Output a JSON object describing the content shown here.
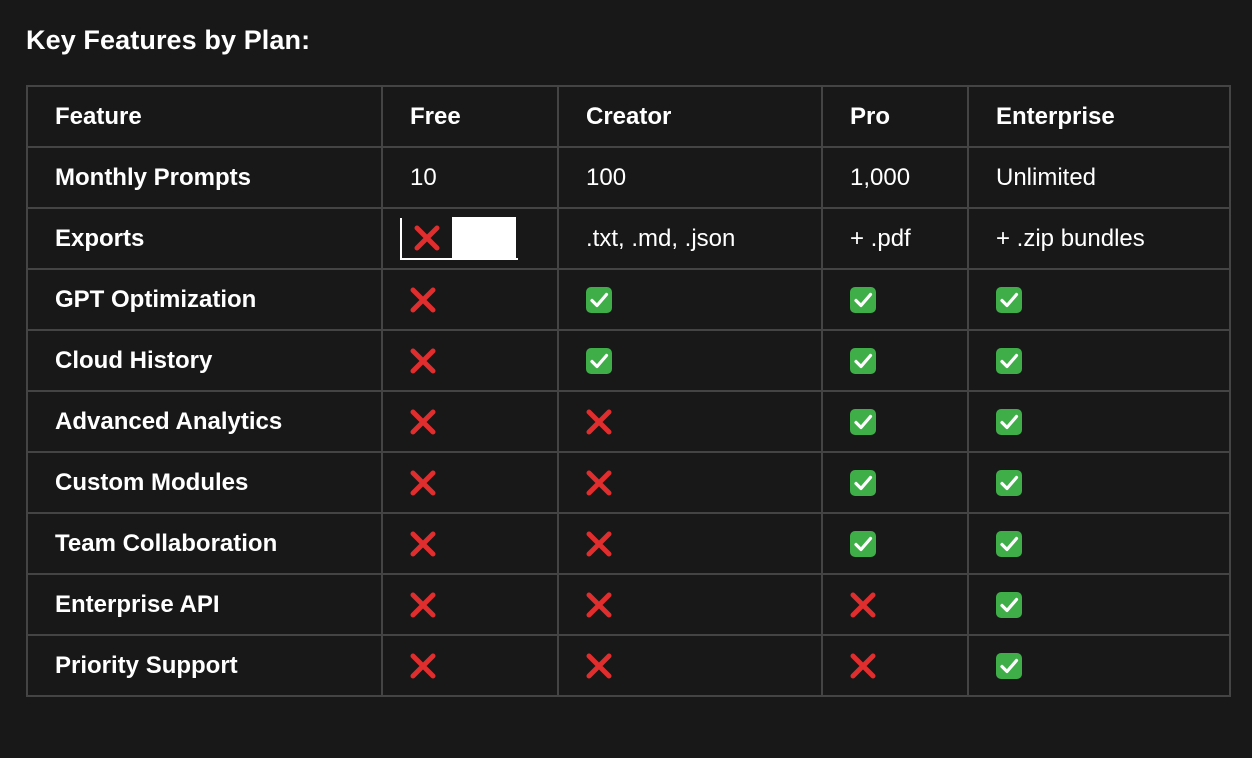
{
  "heading": "Key Features by Plan:",
  "colors": {
    "background": "#181818",
    "border": "#444444",
    "cross": "#e02d2d",
    "check": "#3fae49"
  },
  "table": {
    "headers": [
      "Feature",
      "Free",
      "Creator",
      "Pro",
      "Enterprise"
    ],
    "rows": [
      {
        "feature": "Monthly Prompts",
        "cells": [
          {
            "type": "text",
            "value": "10"
          },
          {
            "type": "text",
            "value": "100"
          },
          {
            "type": "text",
            "value": "1,000"
          },
          {
            "type": "text",
            "value": "Unlimited"
          }
        ]
      },
      {
        "feature": "Exports",
        "cells": [
          {
            "type": "cross-edited"
          },
          {
            "type": "text",
            "value": ".txt, .md, .json"
          },
          {
            "type": "text",
            "value": "+ .pdf"
          },
          {
            "type": "text",
            "value": "+ .zip bundles"
          }
        ]
      },
      {
        "feature": "GPT Optimization",
        "cells": [
          {
            "type": "cross"
          },
          {
            "type": "check"
          },
          {
            "type": "check"
          },
          {
            "type": "check"
          }
        ]
      },
      {
        "feature": "Cloud History",
        "cells": [
          {
            "type": "cross"
          },
          {
            "type": "check"
          },
          {
            "type": "check"
          },
          {
            "type": "check"
          }
        ]
      },
      {
        "feature": "Advanced Analytics",
        "cells": [
          {
            "type": "cross"
          },
          {
            "type": "cross"
          },
          {
            "type": "check"
          },
          {
            "type": "check"
          }
        ]
      },
      {
        "feature": "Custom Modules",
        "cells": [
          {
            "type": "cross"
          },
          {
            "type": "cross"
          },
          {
            "type": "check"
          },
          {
            "type": "check"
          }
        ]
      },
      {
        "feature": "Team Collaboration",
        "cells": [
          {
            "type": "cross"
          },
          {
            "type": "cross"
          },
          {
            "type": "check"
          },
          {
            "type": "check"
          }
        ]
      },
      {
        "feature": "Enterprise API",
        "cells": [
          {
            "type": "cross"
          },
          {
            "type": "cross"
          },
          {
            "type": "cross"
          },
          {
            "type": "check"
          }
        ]
      },
      {
        "feature": "Priority Support",
        "cells": [
          {
            "type": "cross"
          },
          {
            "type": "cross"
          },
          {
            "type": "cross"
          },
          {
            "type": "check"
          }
        ]
      }
    ]
  }
}
